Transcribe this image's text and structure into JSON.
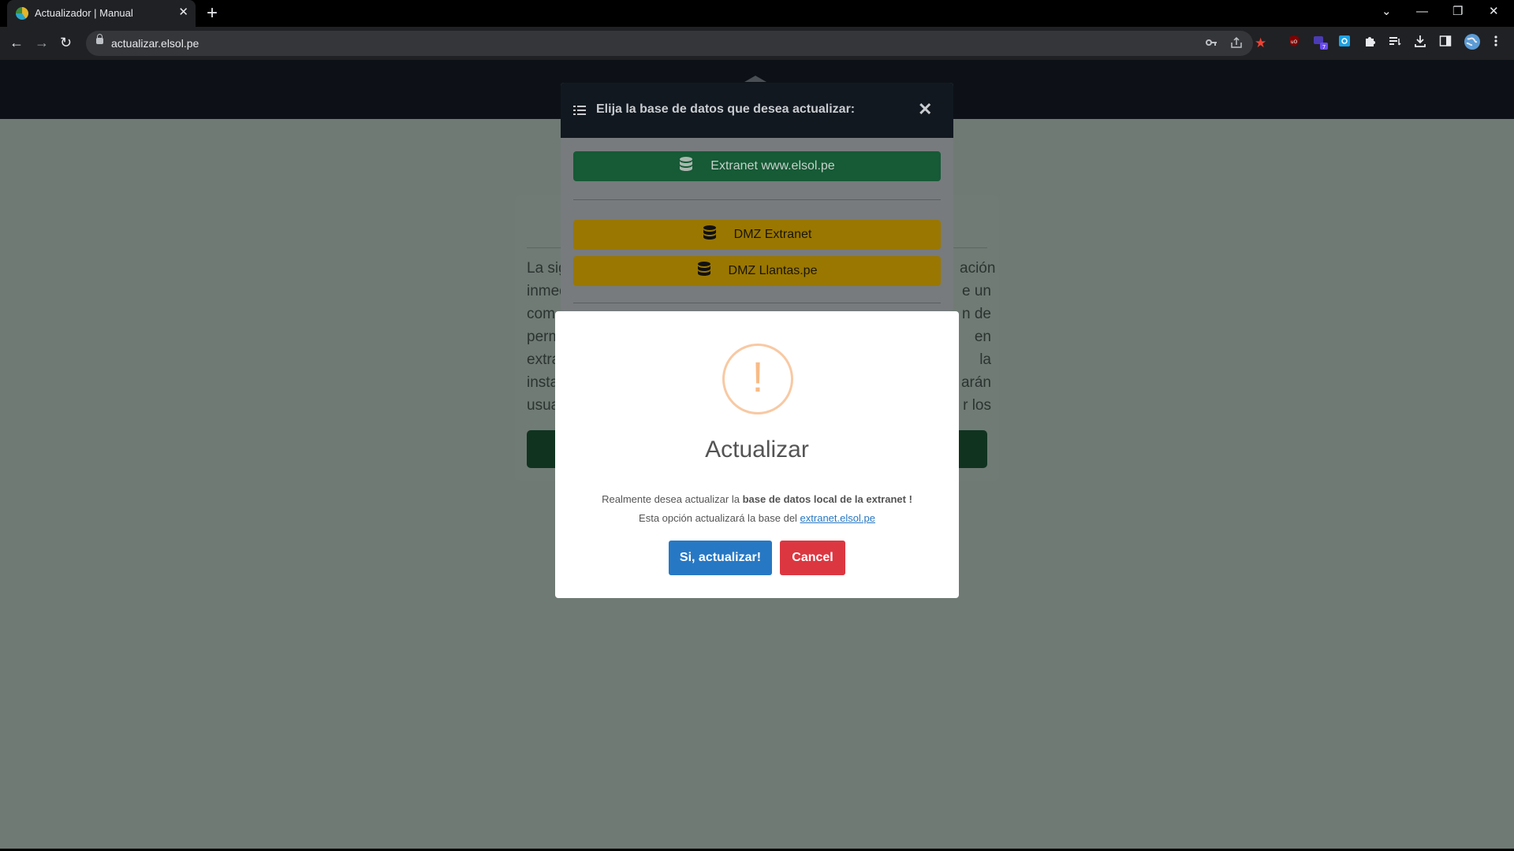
{
  "browser": {
    "tab_title": "Actualizador | Manual",
    "tab_close": "✕",
    "new_tab": "+",
    "url": "actualizar.elsol.pe",
    "window_controls": {
      "dropdown": "⌄",
      "minimize": "—",
      "restore": "❐",
      "close": "✕"
    },
    "nav": {
      "back": "←",
      "forward": "→",
      "reload": "↻"
    }
  },
  "background_card": {
    "left_text": [
      "La sig",
      "inmed",
      "com",
      "perm",
      "extra",
      "insta",
      "usua"
    ],
    "right_text": [
      "ación",
      "e un",
      "n de",
      "en la",
      "arán",
      "r los",
      ""
    ]
  },
  "db_modal": {
    "title": "Elija la base de datos que desea actualizar:",
    "close": "✕",
    "options": [
      {
        "label": "Extranet www.elsol.pe",
        "color": "#165a36"
      },
      {
        "label": "DMZ Extranet",
        "color": "#9a7700"
      },
      {
        "label": "DMZ Llantas.pe",
        "color": "#9a7700"
      }
    ]
  },
  "alert": {
    "icon": "!",
    "title": "Actualizar",
    "line1_prefix": "Realmente desea actualizar la ",
    "line1_bold": "base de datos local de la extranet !",
    "line2_prefix": "Esta opción actualizará la base del ",
    "line2_link": "extranet.elsol.pe",
    "confirm_label": "Si, actualizar!",
    "cancel_label": "Cancel",
    "confirm_color": "#2778c4",
    "cancel_color": "#dc3741"
  }
}
